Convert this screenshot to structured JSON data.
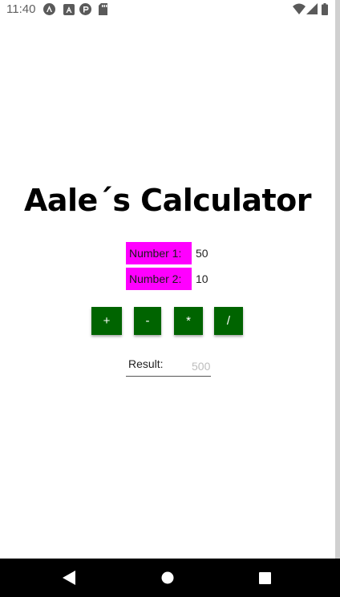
{
  "status_bar": {
    "time": "11:40",
    "left_icons": [
      "android-studio-icon",
      "a-square-icon",
      "pocket-icon",
      "sd-card-icon"
    ],
    "right_icons": [
      "wifi-icon",
      "cellular-signal-icon",
      "battery-icon"
    ]
  },
  "app": {
    "title": "Aale´s Calculator",
    "number1_label": "Number 1:",
    "number1_value": "50",
    "number2_label": "Number 2:",
    "number2_value": "10",
    "ops": [
      "+",
      "-",
      "*",
      "/"
    ],
    "result_label": "Result:",
    "result_value": "500"
  },
  "colors": {
    "label_bg": "#ff00ff",
    "button_bg": "#006400",
    "button_text": "#ffffff",
    "nav_bar": "#000000"
  },
  "nav_bar": {
    "icons": [
      "back-icon",
      "home-icon",
      "recents-icon"
    ]
  }
}
